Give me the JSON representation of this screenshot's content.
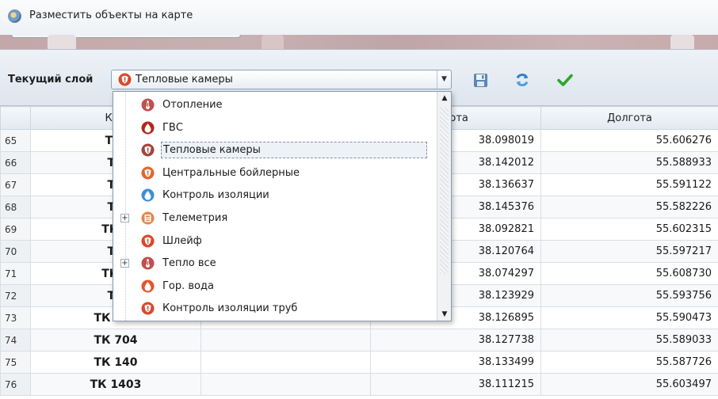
{
  "window": {
    "title": "Разместить объекты на карте"
  },
  "toolbar": {
    "layer_label": "Текущий слой",
    "current_layer": "Тепловые камеры",
    "buttons": [
      "save-icon",
      "refresh-icon",
      "apply-icon"
    ]
  },
  "table": {
    "columns": [
      "Кам",
      "",
      "рота",
      "Долгота"
    ],
    "rows": [
      {
        "n": "65",
        "name": "ТК-",
        "lat": "38.098019",
        "lon": "55.606276"
      },
      {
        "n": "66",
        "name": "ТК",
        "lat": "38.142012",
        "lon": "55.588933"
      },
      {
        "n": "67",
        "name": "ТК",
        "lat": "38.136637",
        "lon": "55.591122"
      },
      {
        "n": "68",
        "name": "ТК",
        "lat": "38.145376",
        "lon": "55.582226"
      },
      {
        "n": "69",
        "name": "ТК 1",
        "lat": "38.092821",
        "lon": "55.602315"
      },
      {
        "n": "70",
        "name": "ТК",
        "lat": "38.120764",
        "lon": "55.597217"
      },
      {
        "n": "71",
        "name": "ТК 1",
        "lat": "38.074297",
        "lon": "55.608730"
      },
      {
        "n": "72",
        "name": "ТК",
        "lat": "38.123929",
        "lon": "55.593756"
      },
      {
        "n": "73",
        "name": "ТК 643",
        "lat": "38.126895",
        "lon": "55.590473"
      },
      {
        "n": "74",
        "name": "ТК 704",
        "lat": "38.127738",
        "lon": "55.589033"
      },
      {
        "n": "75",
        "name": "ТК 140",
        "lat": "38.133499",
        "lon": "55.587726"
      },
      {
        "n": "76",
        "name": "ТК 1403",
        "lat": "38.111215",
        "lon": "55.603497"
      }
    ]
  },
  "dropdown": {
    "items": [
      {
        "label": "Отопление",
        "icon": "thermometer-icon",
        "color": "#c0504d",
        "expandable": false
      },
      {
        "label": "ГВС",
        "icon": "drop-icon",
        "color": "#b3261e",
        "expandable": false
      },
      {
        "label": "Тепловые камеры",
        "icon": "shield-icon",
        "color": "#a0463c",
        "expandable": false,
        "selected": true
      },
      {
        "label": "Центральные бойлерные",
        "icon": "shield-icon",
        "color": "#e0662e",
        "expandable": false
      },
      {
        "label": "Контроль изоляции",
        "icon": "drop-icon",
        "color": "#3a8fd6",
        "expandable": false
      },
      {
        "label": "Телеметрия",
        "icon": "meter-icon",
        "color": "#e0884a",
        "expandable": true
      },
      {
        "label": "Шлейф",
        "icon": "shield-icon",
        "color": "#d9482b",
        "expandable": false
      },
      {
        "label": "Тепло все",
        "icon": "thermometer-icon",
        "color": "#c0504d",
        "expandable": true
      },
      {
        "label": "Гор. вода",
        "icon": "drop-icon",
        "color": "#e2542c",
        "expandable": false
      },
      {
        "label": "Контроль изоляции труб",
        "icon": "shield-icon",
        "color": "#d9482b",
        "expandable": false
      }
    ]
  }
}
